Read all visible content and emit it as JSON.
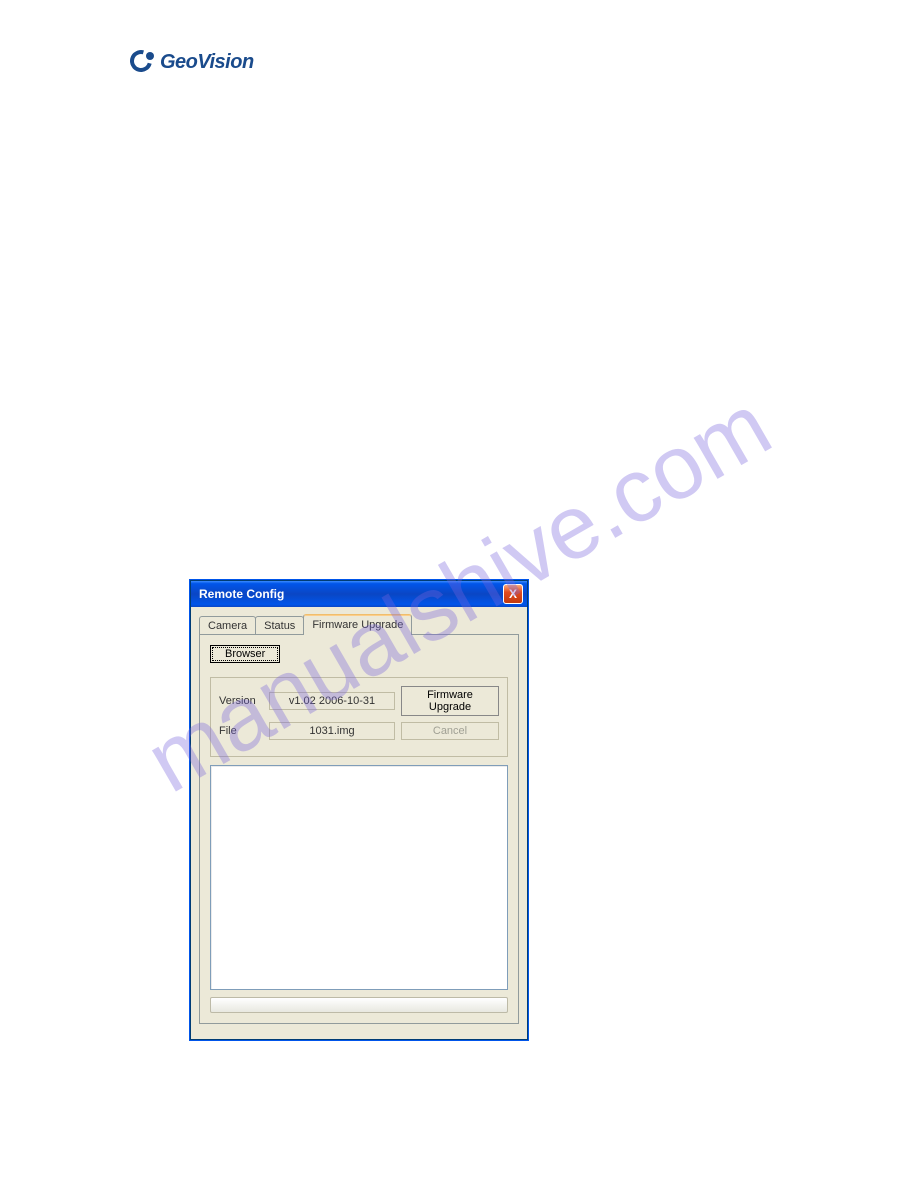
{
  "logo": {
    "brand": "GeoVision"
  },
  "watermark": {
    "text": "manualshive.com"
  },
  "dialog": {
    "title": "Remote Config",
    "close_symbol": "X",
    "tabs": {
      "camera": "Camera",
      "status": "Status",
      "firmware": "Firmware Upgrade"
    },
    "browser_btn": "Browser",
    "version_label": "Version",
    "version_value": "v1.02 2006-10-31",
    "file_label": "File",
    "file_value": "1031.img",
    "upgrade_btn": "Firmware Upgrade",
    "cancel_btn": "Cancel"
  }
}
